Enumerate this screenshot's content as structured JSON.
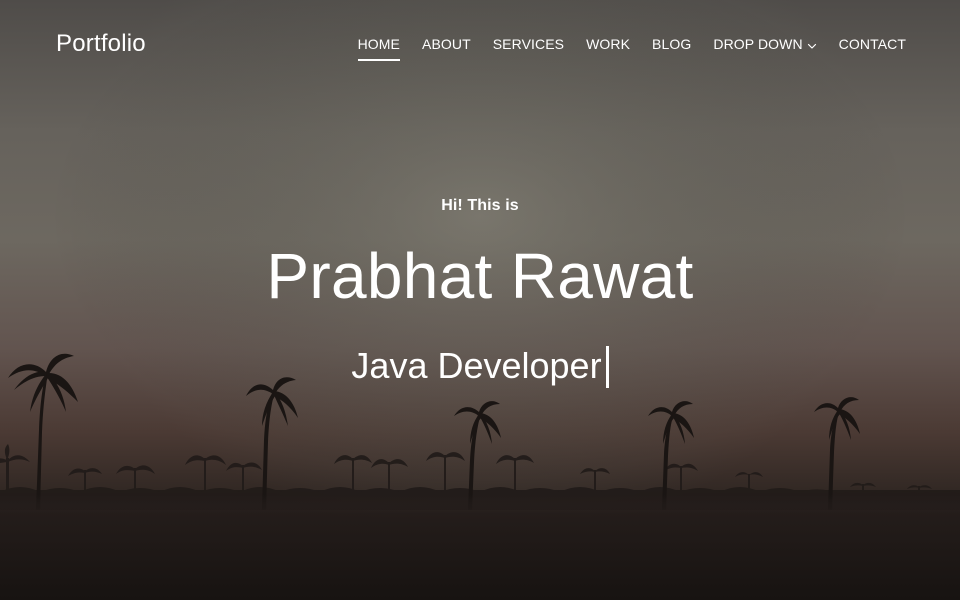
{
  "brand": {
    "name": "Portfolio"
  },
  "nav": {
    "items": [
      {
        "label": "HOME",
        "active": true
      },
      {
        "label": "ABOUT"
      },
      {
        "label": "SERVICES"
      },
      {
        "label": "WORK"
      },
      {
        "label": "BLOG"
      },
      {
        "label": "DROP DOWN",
        "has_dropdown": true,
        "icon": "chevron-down-icon"
      },
      {
        "label": "CONTACT"
      }
    ]
  },
  "hero": {
    "intro": "Hi! This is",
    "name": "Prabhat Rawat",
    "role": "Java Developer"
  },
  "colors": {
    "text": "#ffffff",
    "sky_top": "#4f4c49",
    "sky_mid": "#6d6860",
    "horizon": "#4b3a34",
    "ground": "#1f1a17"
  }
}
